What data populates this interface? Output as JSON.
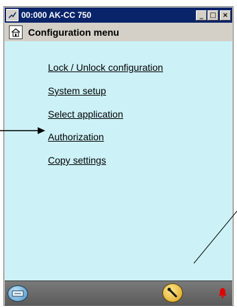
{
  "window": {
    "title": "00:000 AK-CC 750",
    "buttons": {
      "minimize": "_",
      "maximize": "□",
      "close": "×"
    }
  },
  "header": {
    "title": "Configuration menu"
  },
  "menu": {
    "items": [
      "Lock / Unlock configuration",
      "System setup",
      "Select application",
      "Authorization",
      "Copy settings"
    ]
  },
  "colors": {
    "titlebar": "#0a246a",
    "content_bg": "#ccf2f8",
    "statusbar": "#6a6a6a",
    "alarm": "#e00000",
    "tool_button": "#e6b43a",
    "keyboard_button": "#7fb7e0"
  },
  "icons": {
    "app": "app-icon",
    "home": "home-icon",
    "keyboard": "keyboard-icon",
    "tool": "wrench-icon",
    "alarm": "alarm-bell-icon"
  }
}
